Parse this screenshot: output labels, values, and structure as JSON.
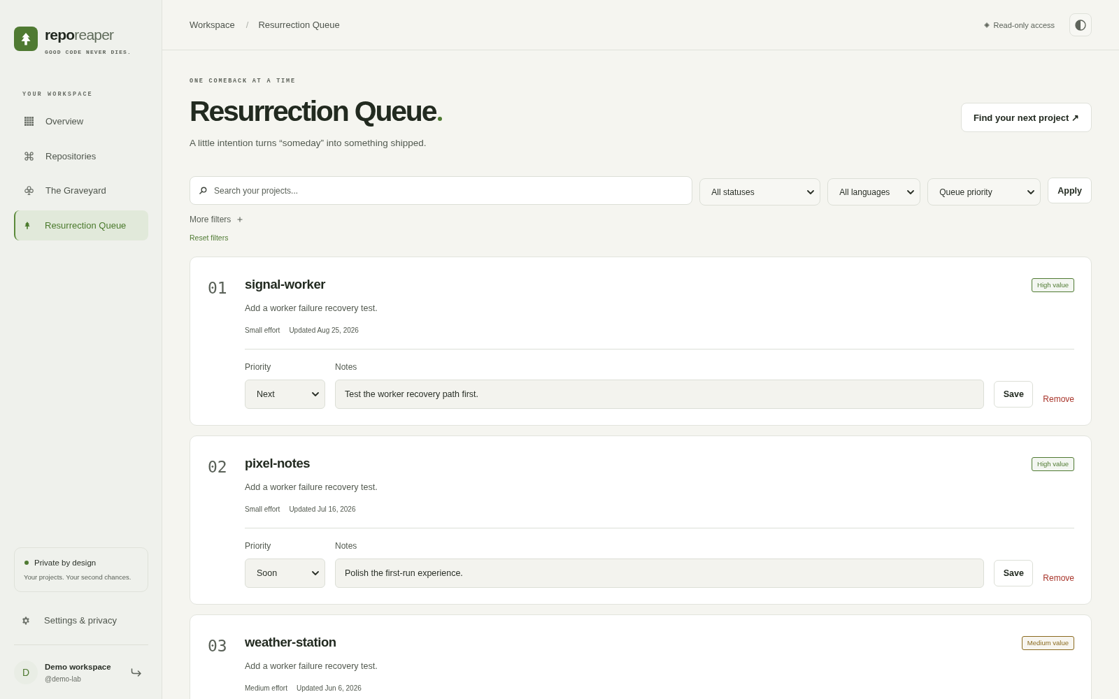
{
  "sidebar": {
    "brand": {
      "name": "**repo**reaper",
      "tagline": "GOOD CODE NEVER DIES."
    },
    "section_label": "YOUR WORKSPACE",
    "items": [
      {
        "label": "Overview",
        "selected": false
      },
      {
        "label": "Repositories",
        "selected": false
      },
      {
        "label": "The Graveyard",
        "selected": false
      },
      {
        "label": "Resurrection Queue",
        "selected": true
      }
    ],
    "privacy_card": {
      "title": "Private by design",
      "text": "Your projects. Your second chances."
    },
    "settings": {
      "label": "Settings & privacy"
    },
    "user": {
      "avatar": "D",
      "name": "Demo workspace",
      "handle": "@demo-lab"
    }
  },
  "header": {
    "breadcrumb": [
      "Workspace",
      "Resurrection Queue"
    ],
    "separator": "/",
    "access": "Read-only access"
  },
  "page": {
    "eyebrow": "ONE COMEBACK AT A TIME",
    "title": "Resurrection Queue",
    "subtitle": "A little intention turns “someday” into something shipped.",
    "action": "Find your next project ↗"
  },
  "filters": {
    "search": {
      "placeholder": "Search your projects..."
    },
    "selects": [
      {
        "value": "All statuses"
      },
      {
        "value": "All languages"
      },
      {
        "value": "Queue priority"
      }
    ],
    "apply": "Apply",
    "more": "More filters",
    "reset": "Reset filters"
  },
  "projects": [
    {
      "number": "01",
      "name": "signal-worker",
      "badge": {
        "label": "High value",
        "color": "#4f7a32"
      },
      "description": "Add a worker failure recovery test.",
      "effort": "Small effort",
      "updated": "Updated Aug 25, 2026",
      "priority_label": "Priority",
      "priority": "Next",
      "notes_label": "Notes",
      "notes": "Test the worker recovery path first.",
      "save": "Save",
      "remove": "Remove"
    },
    {
      "number": "02",
      "name": "pixel-notes",
      "badge": {
        "label": "High value",
        "color": "#4f7a32"
      },
      "description": "Add a worker failure recovery test.",
      "effort": "Small effort",
      "updated": "Updated Jul 16, 2026",
      "priority_label": "Priority",
      "priority": "Soon",
      "notes_label": "Notes",
      "notes": "Polish the first-run experience.",
      "save": "Save",
      "remove": "Remove"
    },
    {
      "number": "03",
      "name": "weather-station",
      "badge": {
        "label": "Medium value",
        "color": "#8a6a1f"
      },
      "description": "Add a worker failure recovery test.",
      "effort": "Medium effort",
      "updated": "Updated Jun 6, 2026"
    }
  ]
}
